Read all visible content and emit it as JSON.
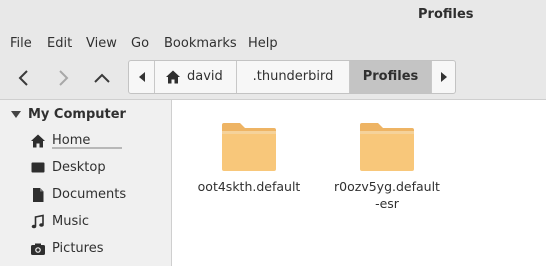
{
  "window": {
    "title": "Profiles"
  },
  "menu": [
    "File",
    "Edit",
    "View",
    "Go",
    "Bookmarks",
    "Help"
  ],
  "pathbar": {
    "segments": [
      {
        "label": "david",
        "icon": "home-icon"
      },
      {
        "label": ".thunderbird"
      },
      {
        "label": "Profiles",
        "active": true
      }
    ]
  },
  "sidebar": {
    "heading": "My Computer",
    "items": [
      {
        "label": "Home",
        "icon": "home-icon"
      },
      {
        "label": "Desktop",
        "icon": "desktop-icon"
      },
      {
        "label": "Documents",
        "icon": "document-icon"
      },
      {
        "label": "Music",
        "icon": "music-note-icon"
      },
      {
        "label": "Pictures",
        "icon": "camera-icon"
      }
    ]
  },
  "files": [
    {
      "name": "oot4skth.default",
      "type": "folder"
    },
    {
      "name": "r0ozv5yg.default-esr",
      "type": "folder"
    }
  ],
  "colors": {
    "folder_body": "#f8c77a",
    "folder_back": "#eeb464",
    "active_crumb": "#c4c4c4",
    "chrome": "#e8e8e8"
  }
}
